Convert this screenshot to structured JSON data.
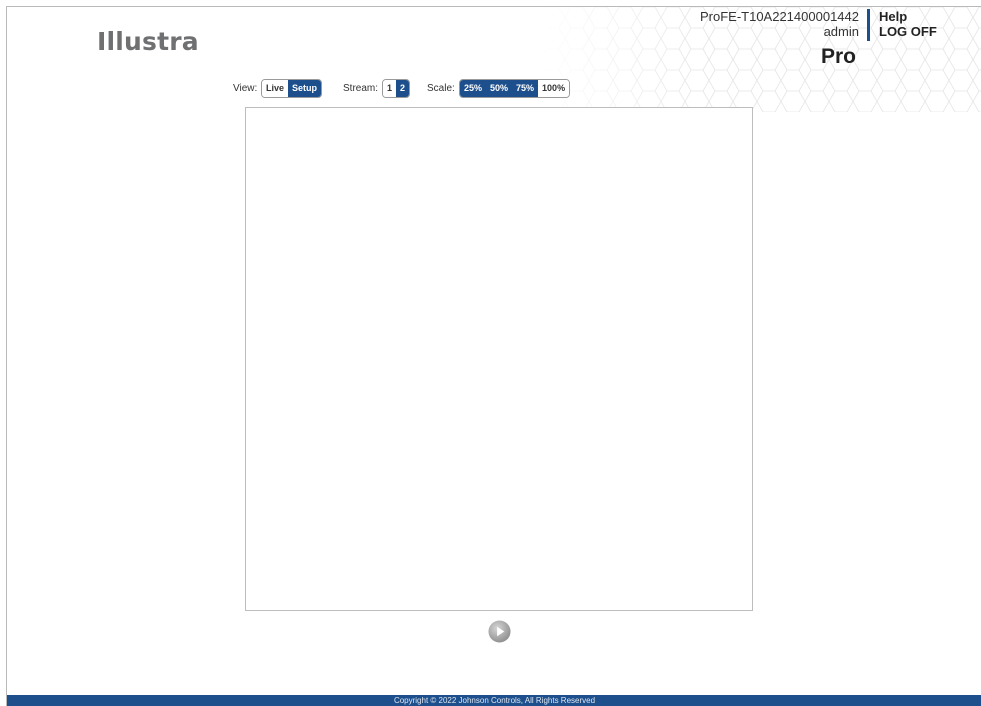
{
  "brand": {
    "logo_text": "Illustra",
    "product_tier": "Pro"
  },
  "device": {
    "name": "ProFE-T10A221400001442",
    "user": "admin"
  },
  "header_links": {
    "help": "Help",
    "logoff": "LOG OFF"
  },
  "view": {
    "label": "View:",
    "options": [
      "Live",
      "Setup"
    ],
    "selected": "Setup"
  },
  "stream": {
    "label": "Stream:",
    "options": [
      "1",
      "2"
    ],
    "selected": "2"
  },
  "scale": {
    "label": "Scale:",
    "options": [
      "25%",
      "50%",
      "75%",
      "100%"
    ],
    "highlighted": [
      "25%",
      "50%",
      "75%"
    ]
  },
  "player": {
    "icon": "play-icon"
  },
  "footer": {
    "copyright": "Copyright © 2022 Johnson Controls, All Rights Reserved"
  },
  "colors": {
    "accent": "#1d4f8c",
    "logo_gray": "#6f7072"
  }
}
